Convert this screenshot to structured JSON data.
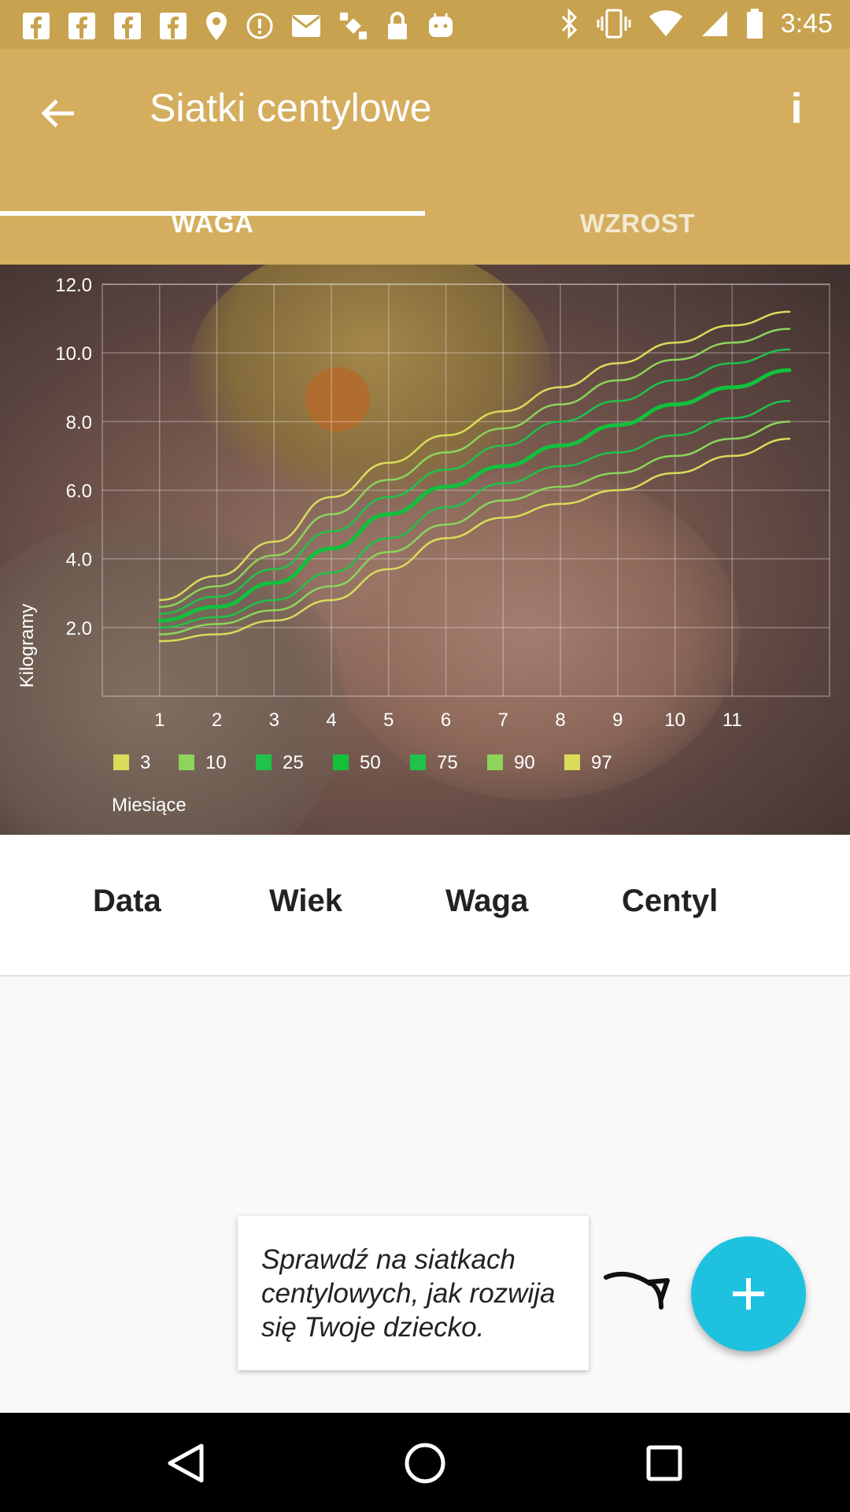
{
  "status_bar": {
    "time": "3:45",
    "left_icons": [
      "fb-icon",
      "fb-icon",
      "fb-icon",
      "fb-icon",
      "maps-pin-icon",
      "info-circle-icon",
      "mail-icon",
      "satellite-icon",
      "lock-icon",
      "android-icon"
    ],
    "right_icons": [
      "bluetooth-icon",
      "vibrate-icon",
      "wifi-icon",
      "signal-icon",
      "battery-icon"
    ]
  },
  "app_bar": {
    "title": "Siatki centylowe",
    "back_icon": "arrow-back-icon",
    "info_label": "i",
    "colors": {
      "toolbar": "#d4ae5e",
      "status": "#c8a24e"
    }
  },
  "tabs": [
    {
      "label": "WAGA",
      "active": true
    },
    {
      "label": "WZROST",
      "active": false
    }
  ],
  "chart_data": {
    "type": "line",
    "x": [
      1,
      2,
      3,
      4,
      5,
      6,
      7,
      8,
      9,
      10,
      11,
      12
    ],
    "x_tick_labels": [
      "1",
      "2",
      "3",
      "4",
      "5",
      "6",
      "7",
      "8",
      "9",
      "10",
      "11"
    ],
    "y_tick_labels": [
      "2.0",
      "4.0",
      "6.0",
      "8.0",
      "10.0",
      "12.0"
    ],
    "ylim": [
      0,
      12.0
    ],
    "xlim": [
      0,
      12.7
    ],
    "ylabel": "Kilogramy",
    "xlabel": "Miesiące",
    "grid": true,
    "legend_placement": "bottom",
    "series": [
      {
        "name": "3",
        "color": "#d8dc5a",
        "values": [
          1.6,
          1.8,
          2.2,
          2.8,
          3.7,
          4.6,
          5.2,
          5.6,
          6.0,
          6.5,
          7.0,
          7.5
        ]
      },
      {
        "name": "10",
        "color": "#8cd45a",
        "values": [
          1.8,
          2.1,
          2.5,
          3.2,
          4.2,
          5.0,
          5.7,
          6.1,
          6.5,
          7.0,
          7.5,
          8.0
        ]
      },
      {
        "name": "25",
        "color": "#1fc24a",
        "values": [
          2.0,
          2.3,
          2.8,
          3.6,
          4.6,
          5.5,
          6.2,
          6.7,
          7.1,
          7.6,
          8.1,
          8.6
        ]
      },
      {
        "name": "50",
        "color": "#12c03c",
        "values": [
          2.2,
          2.6,
          3.3,
          4.3,
          5.3,
          6.1,
          6.7,
          7.3,
          7.9,
          8.5,
          9.0,
          9.5
        ]
      },
      {
        "name": "75",
        "color": "#1fc24a",
        "values": [
          2.4,
          2.9,
          3.7,
          4.8,
          5.8,
          6.6,
          7.3,
          8.0,
          8.6,
          9.2,
          9.7,
          10.1
        ]
      },
      {
        "name": "90",
        "color": "#8cd45a",
        "values": [
          2.6,
          3.2,
          4.1,
          5.3,
          6.3,
          7.1,
          7.8,
          8.5,
          9.2,
          9.8,
          10.3,
          10.7
        ]
      },
      {
        "name": "97",
        "color": "#d8dc5a",
        "values": [
          2.8,
          3.5,
          4.5,
          5.8,
          6.8,
          7.6,
          8.3,
          9.0,
          9.7,
          10.3,
          10.8,
          11.2
        ]
      }
    ]
  },
  "table": {
    "headers": [
      "Data",
      "Wiek",
      "Waga",
      "Centyl"
    ]
  },
  "hint": {
    "text": "Sprawdź na siatkach centylowych, jak rozwija się Twoje dziecko."
  },
  "fab": {
    "icon": "plus-icon",
    "color": "#1ec2df"
  },
  "nav_bar": {
    "icons": [
      "back-triangle-icon",
      "home-circle-icon",
      "recents-square-icon"
    ]
  }
}
